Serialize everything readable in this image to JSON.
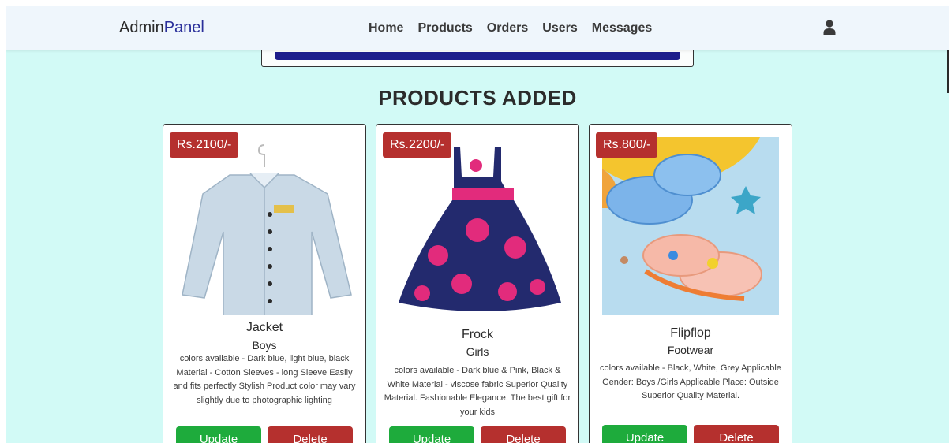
{
  "header": {
    "brand_main": "Admin",
    "brand_accent": "Panel",
    "nav": [
      "Home",
      "Products",
      "Orders",
      "Users",
      "Messages"
    ],
    "user_icon": "user-icon"
  },
  "section_title": "PRODUCTS ADDED",
  "products": [
    {
      "price": "Rs.2100/-",
      "name": "Jacket",
      "category": "Boys",
      "description": "colors available - Dark blue, light blue, black Material - Cotton Sleeves - long Sleeve Easily and fits perfectly Stylish Product color may vary slightly due to photographic lighting",
      "update_label": "Update",
      "delete_label": "Delete"
    },
    {
      "price": "Rs.2200/-",
      "name": "Frock",
      "category": "Girls",
      "description": "colors available - Dark blue & Pink, Black & White Material - viscose fabric Superior Quality Material. Fashionable Elegance. The best gift for your kids",
      "update_label": "Update",
      "delete_label": "Delete"
    },
    {
      "price": "Rs.800/-",
      "name": "Flipflop",
      "category": "Footwear",
      "description": "colors available - Black, White, Grey Applicable Gender: Boys /Girls Applicable Place: Outside Superior Quality Material.",
      "update_label": "Update",
      "delete_label": "Delete"
    }
  ],
  "colors": {
    "page_bg": "#d2faf6",
    "header_bg": "#eff6fc",
    "brand_accent": "#2a2f9a",
    "price_tag": "#b5302e",
    "update_btn": "#1eab3c",
    "delete_btn": "#b5302e"
  }
}
